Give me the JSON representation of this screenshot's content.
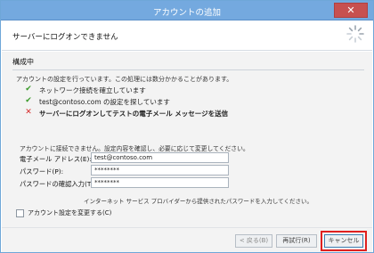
{
  "window": {
    "title": "アカウントの追加",
    "close_glyph": "✕"
  },
  "header": {
    "heading": "サーバーにログオンできません"
  },
  "content": {
    "section_title": "構成中",
    "description": "アカウントの設定を行っています。この処理には数分かかることがあります。",
    "steps": [
      {
        "status": "ok",
        "label": "ネットワーク接続を確立しています"
      },
      {
        "status": "ok",
        "label": "test@contoso.com の設定を探しています"
      },
      {
        "status": "fail",
        "label": "サーバーにログオンしてテストの電子メール メッセージを送信"
      }
    ],
    "info_text": "アカウントに接続できません。設定内容を確認し、必要に応じて変更してください。",
    "fields": {
      "email": {
        "label": "電子メール アドレス(E):",
        "value": "test@contoso.com"
      },
      "password": {
        "label": "パスワード(P):",
        "value": "********"
      },
      "password_confirm": {
        "label": "パスワードの確認入力(T):",
        "value": "********"
      }
    },
    "hint": "インターネット サービス プロバイダーから提供されたパスワードを入力してください。",
    "change_settings_label": "アカウント設定を変更する(C)"
  },
  "footer": {
    "back_label": "< 戻る(B)",
    "next_label": "再試行(R)",
    "cancel_label": "キャンセル"
  },
  "colors": {
    "titlebar": "#74a9df",
    "ok": "#3a9a2a",
    "fail": "#d62c2c",
    "highlight": "#e0201f"
  },
  "icons": {
    "ok": "checkmark-icon",
    "fail": "x-icon",
    "busy": "busy-spinner-icon"
  }
}
